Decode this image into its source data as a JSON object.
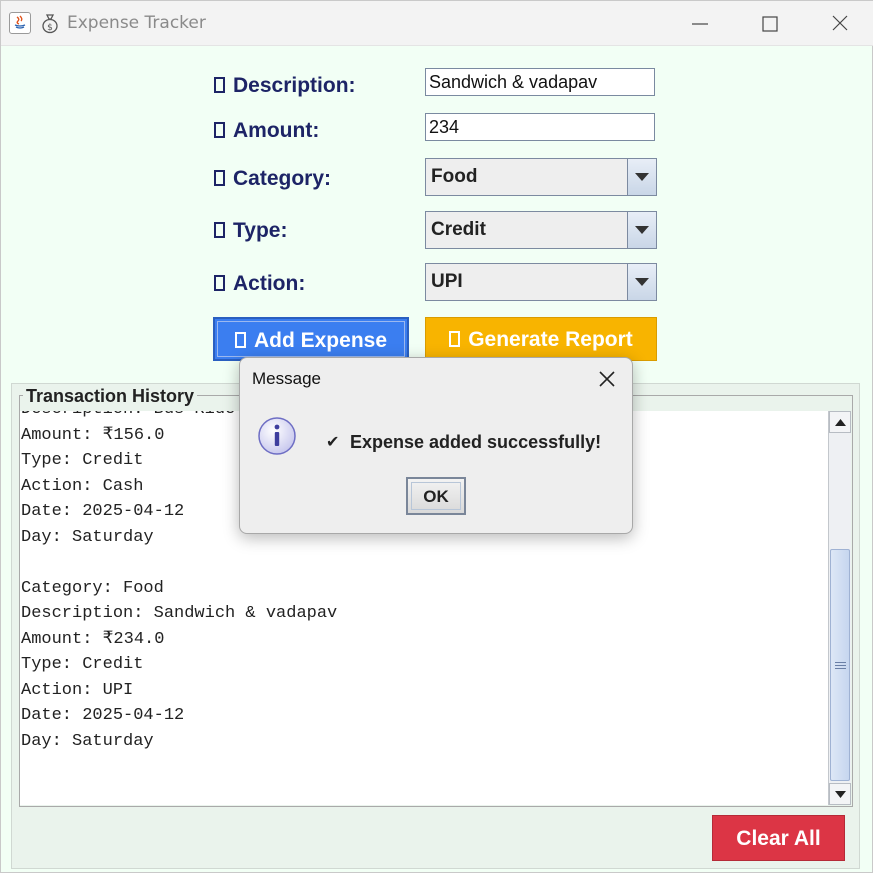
{
  "window": {
    "title": "Expense Tracker"
  },
  "form": {
    "description_label": "Description:",
    "amount_label": "Amount:",
    "category_label": "Category:",
    "type_label": "Type:",
    "action_label": "Action:",
    "description_value": "Sandwich & vadapav",
    "amount_value": "234",
    "category_value": "Food",
    "type_value": "Credit",
    "action_value": "UPI",
    "add_button": "Add Expense",
    "report_button": "Generate Report"
  },
  "history": {
    "title": "Transaction History",
    "lines": [
      "Description: Bus Ride",
      "Amount: ₹156.0",
      "Type: Credit",
      "Action: Cash",
      "Date: 2025-04-12",
      "Day: Saturday",
      "",
      "Category: Food",
      "Description: Sandwich & vadapav",
      "Amount: ₹234.0",
      "Type: Credit",
      "Action: UPI",
      "Date: 2025-04-12",
      "Day: Saturday"
    ],
    "clear_button": "Clear All"
  },
  "dialog": {
    "title": "Message",
    "check_glyph": "✔",
    "message": "Expense added successfully!",
    "ok_button": "OK"
  },
  "colors": {
    "background": "#f2fff5",
    "label_text": "#1d2466",
    "add_button": "#3b7ef0",
    "report_button": "#f8b400",
    "clear_button": "#dc3545"
  },
  "icons": [
    "java-icon",
    "money-bag-icon",
    "minimize-icon",
    "maximize-icon",
    "close-icon",
    "info-icon",
    "chevron-down-icon"
  ]
}
